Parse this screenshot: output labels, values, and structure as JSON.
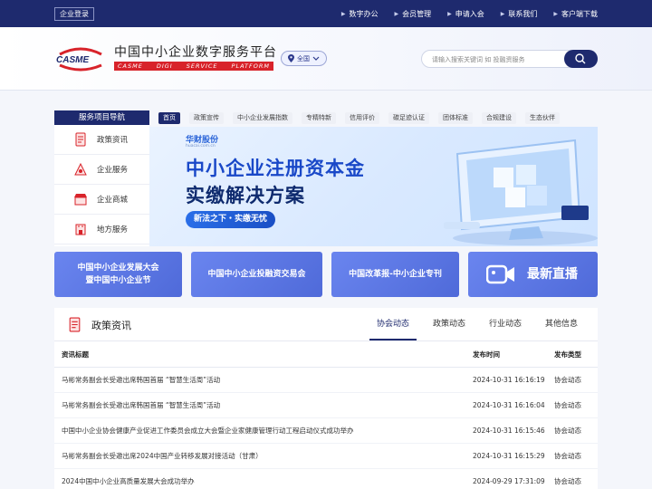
{
  "topbar": {
    "login_label": "企业登录",
    "nav": [
      "数字办公",
      "会员管理",
      "申请入会",
      "联系我们",
      "客户端下载"
    ]
  },
  "header": {
    "logo_text": "CASME",
    "site_title": "中国中小企业数字服务平台",
    "site_subtitle_words": [
      "CASME",
      "DIGI",
      "SERVICE",
      "PLATFORM"
    ],
    "region": "全国",
    "search_placeholder": "请输入搜索关键词 如 投融资服务"
  },
  "service_nav": {
    "title": "服务项目导航",
    "items": [
      {
        "label": "政策资讯",
        "icon": "document-icon"
      },
      {
        "label": "企业服务",
        "icon": "service-icon"
      },
      {
        "label": "企业商城",
        "icon": "shop-icon"
      },
      {
        "label": "地方服务",
        "icon": "building-icon"
      }
    ]
  },
  "tabs": [
    "首页",
    "政策宣传",
    "中小企业发展指数",
    "专精特新",
    "信用评价",
    "碳足迹认证",
    "团体标准",
    "合规建设",
    "生态伙伴"
  ],
  "banner": {
    "brand": "华财股份",
    "brand_url": "huacai.com.cn",
    "line1": "中小企业注册资本金",
    "line2": "实缴解决方案",
    "pill": "新法之下・实缴无忧"
  },
  "cards": [
    {
      "line1": "中国中小企业发展大会",
      "line2": "暨中国中小企业节"
    },
    {
      "line1": "中国中小企业投融资交易会"
    },
    {
      "line1": "中国改革报-中小企业专刊"
    },
    {
      "line1": "最新直播",
      "icon": "video-camera-icon"
    }
  ],
  "policy": {
    "title": "政策资讯",
    "tabs": [
      "协会动态",
      "政策动态",
      "行业动态",
      "其他信息"
    ],
    "columns": [
      "资讯标题",
      "发布时间",
      "发布类型"
    ],
    "rows": [
      {
        "title": "马彬常务副会长受邀出席韩国首届 “智慧生活周”活动",
        "date": "2024-10-31 16:16:19",
        "type": "协会动态"
      },
      {
        "title": "马彬常务副会长受邀出席韩国首届 “智慧生活周”活动",
        "date": "2024-10-31 16:16:04",
        "type": "协会动态"
      },
      {
        "title": "中国中小企业协会健康产业促进工作委员会成立大会暨企业家健康管理行动工程启动仪式成功举办",
        "date": "2024-10-31 16:15:46",
        "type": "协会动态"
      },
      {
        "title": "马彬常务副会长受邀出席2024中国产业转移发展对接活动（甘肃）",
        "date": "2024-10-31 16:15:29",
        "type": "协会动态"
      },
      {
        "title": "2024中国中小企业高质量发展大会成功举办",
        "date": "2024-09-29 17:31:09",
        "type": "协会动态"
      }
    ]
  },
  "colors": {
    "primary": "#1e2a6e",
    "accent_red": "#d8232a",
    "card": "#5f7ae6"
  }
}
